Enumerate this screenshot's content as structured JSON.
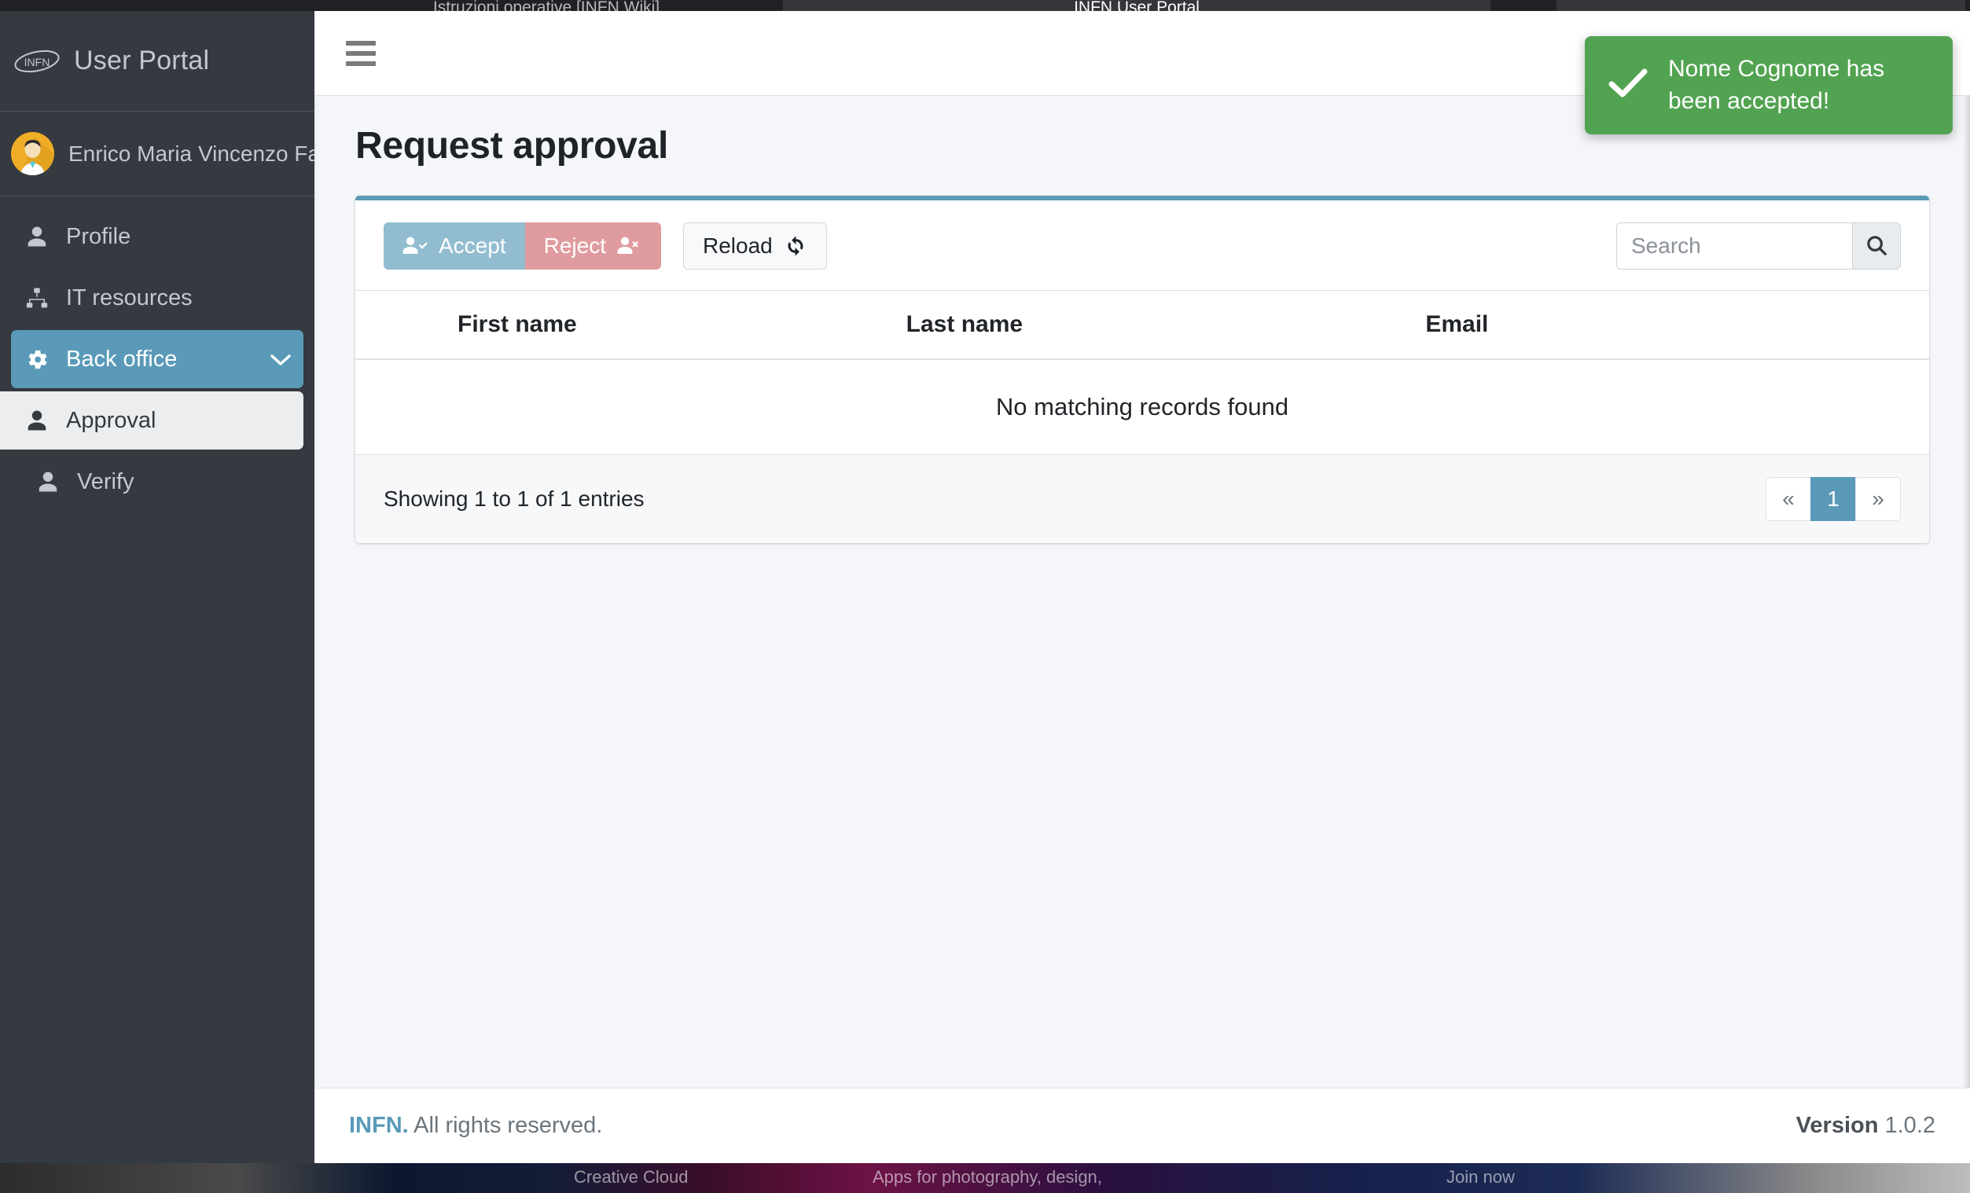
{
  "browser": {
    "tabs": [
      {
        "title": "Istruzioni operative [INFN Wiki]",
        "active": false
      },
      {
        "title": "INFN User Portal",
        "active": true
      },
      {
        "title": "",
        "active": false
      }
    ]
  },
  "desktop": {
    "ad_lines": [
      "Creative Cloud",
      "Apps for photography, design,",
      "Join now"
    ]
  },
  "sidebar": {
    "brand": {
      "logo": "infn-logo",
      "title": "User Portal"
    },
    "user": {
      "avatar": "user-avatar",
      "name": "Enrico Maria Vincenzo Fa"
    },
    "items": [
      {
        "label": "Profile",
        "icon": "user-icon",
        "state": "default"
      },
      {
        "label": "IT resources",
        "icon": "sitemap-icon",
        "state": "default"
      },
      {
        "label": "Back office",
        "icon": "gear-icon",
        "state": "active",
        "chevron": "⌄"
      },
      {
        "label": "Approval",
        "icon": "user-icon",
        "state": "sub-active"
      },
      {
        "label": "Verify",
        "icon": "user-icon",
        "state": "sub"
      }
    ]
  },
  "topbar": {
    "menu_toggle": "hamburger-icon"
  },
  "main": {
    "page_title": "Request approval",
    "toolbar": {
      "accept_label": "Accept",
      "reject_label": "Reject",
      "reload_label": "Reload"
    },
    "search": {
      "value": "",
      "placeholder": "Search",
      "button_icon": "search-icon"
    },
    "table": {
      "columns": [
        "First name",
        "Last name",
        "Email"
      ],
      "rows": [],
      "empty_message": "No matching records found"
    },
    "entries_info": "Showing 1 to 1 of 1 entries",
    "pagination": {
      "prev": "«",
      "next": "»",
      "pages": [
        "1"
      ],
      "current": "1"
    }
  },
  "footer": {
    "brand": "INFN.",
    "rights": " All rights reserved.",
    "version_label": "Version",
    "version_number": "1.0.2"
  },
  "toast": {
    "icon": "check-icon",
    "message": "Nome Cognome has been accepted!",
    "color": "#52a351"
  },
  "colors": {
    "sidebar_bg": "#343a40",
    "accent": "#5a9ab8",
    "accept": "#92bdd0",
    "reject": "#e09b9e",
    "content_bg": "#f4f6f9",
    "success": "#52a351"
  }
}
